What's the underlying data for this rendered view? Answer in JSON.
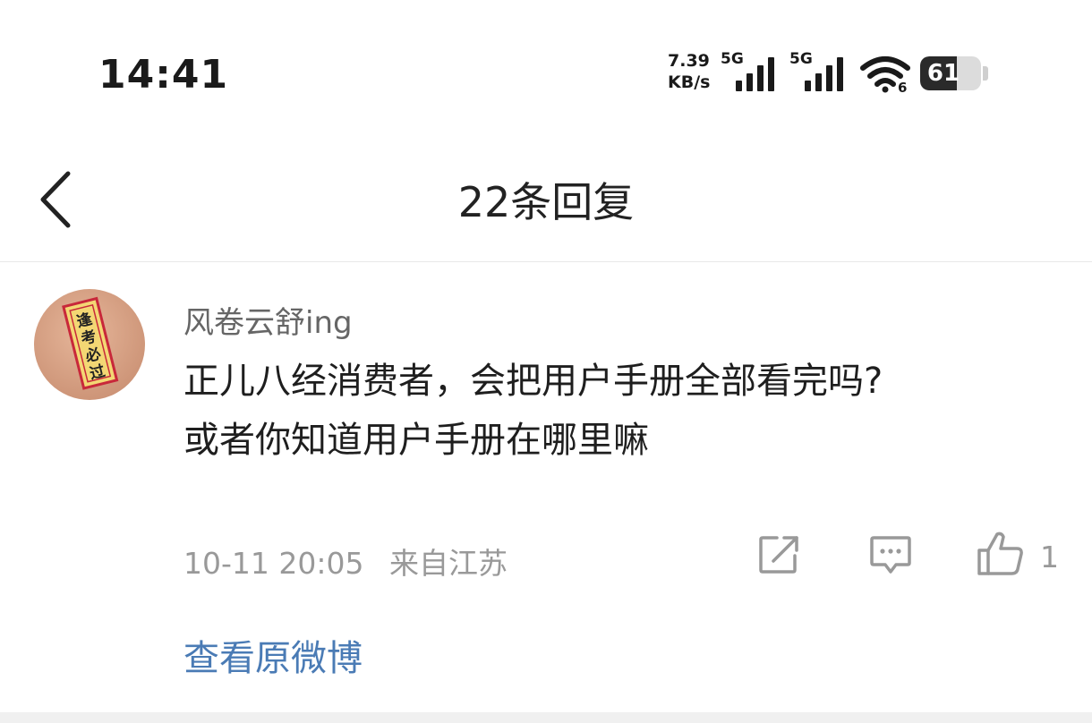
{
  "status_bar": {
    "time": "14:41",
    "net_speed_value": "7.39",
    "net_speed_unit": "KB/s",
    "sim1_label": "5G",
    "sim2_label": "5G",
    "wifi_badge": "6",
    "battery_level": "61"
  },
  "header": {
    "title": "22条回复"
  },
  "reply": {
    "username": "风卷云舒ing",
    "content_line1": "正儿八经消费者，会把用户手册全部看完吗?",
    "content_line2": "或者你知道用户手册在哪里嘛",
    "date": "10-11 20:05",
    "location": "来自江苏",
    "like_count": "1",
    "view_original": "查看原微博",
    "avatar_seal_text": "逢考必过"
  },
  "colors": {
    "link": "#4a7bb5",
    "meta_text": "#999999",
    "username": "#666666"
  }
}
